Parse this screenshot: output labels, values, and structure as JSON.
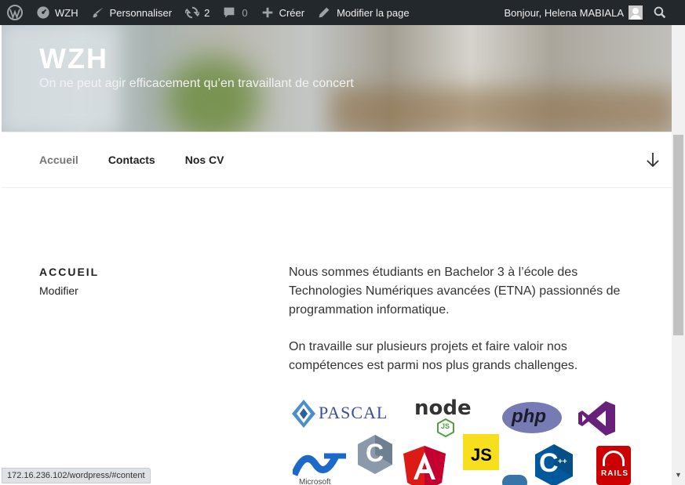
{
  "adminbar": {
    "site_name": "WZH",
    "customize": "Personnaliser",
    "updates_count": "2",
    "comments_count": "0",
    "create": "Créer",
    "edit_page": "Modifier la page",
    "greeting": "Bonjour, Helena MABIALA",
    "icons": [
      "wordpress-icon",
      "dashboard-icon",
      "brush-icon",
      "refresh-icon",
      "comment-icon",
      "plus-icon",
      "pencil-icon",
      "search-icon"
    ]
  },
  "header": {
    "title": "WZH",
    "description": "On ne peut agir efficacement qu’en travaillant de concert"
  },
  "nav": {
    "items": [
      "Accueil",
      "Contacts",
      "Nos CV"
    ]
  },
  "content": {
    "page_title": "ACCUEIL",
    "edit_link": "Modifier",
    "paragraph1": "Nous sommes étudiants en Bachelor 3 à l’école des Technologies Numériques avancées (ETNA) passionnés de programmation informatique.",
    "paragraph2": "On travaille sur plusieurs projets et faire valoir nos compétences est parmi nos plus grands challenges.",
    "logos": {
      "pascal": "PASCAL",
      "node": "node",
      "node_js": "JS",
      "php": "php",
      "c": "C",
      "js": "JS",
      "cpp": "C",
      "cpp_plus": "++",
      "microsoft": "Microsoft",
      "rails": "RAILS"
    }
  },
  "statusbar": {
    "url": "172.16.236.102/wordpress/#content"
  },
  "colors": {
    "adminbar_bg": "#23282d",
    "php": "#777bb3",
    "node": "#539e43",
    "visual_studio": "#68217a",
    "angular": "#dd1b16",
    "js": "#f7df1e",
    "cpp": "#00599c",
    "rails": "#cc0000"
  }
}
